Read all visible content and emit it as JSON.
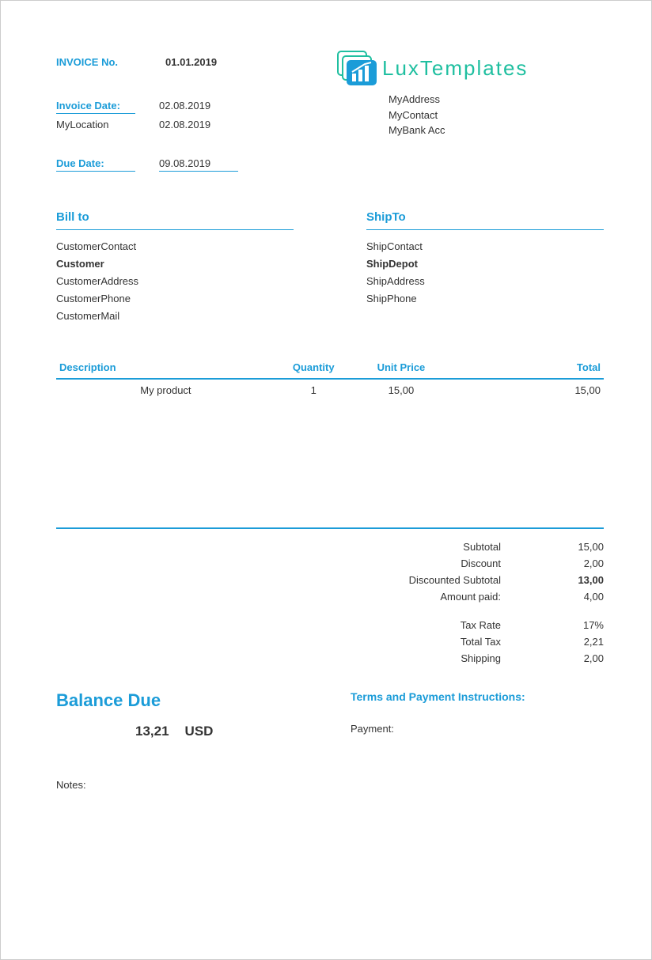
{
  "header": {
    "invoice_no_label": "INVOICE No.",
    "invoice_no_value": "01.01.2019",
    "invoice_date_label": "Invoice Date:",
    "invoice_date_value": "02.08.2019",
    "location_label": "MyLocation",
    "location_value": "02.08.2019",
    "due_date_label": "Due Date:",
    "due_date_value": "09.08.2019"
  },
  "company": {
    "logo_text": "LuxTemplates",
    "address": "MyAddress",
    "contact": "MyContact",
    "bank": "MyBank Acc"
  },
  "billto": {
    "title": "Bill to",
    "contact": "CustomerContact",
    "name": "Customer",
    "address": "CustomerAddress",
    "phone": "CustomerPhone",
    "mail": "CustomerMail"
  },
  "shipto": {
    "title": "ShipTo",
    "contact": "ShipContact",
    "name": "ShipDepot",
    "address": "ShipAddress",
    "phone": "ShipPhone"
  },
  "items": {
    "headers": {
      "description": "Description",
      "quantity": "Quantity",
      "unit_price": "Unit Price",
      "total": "Total"
    },
    "rows": [
      {
        "description": "My product",
        "quantity": "1",
        "unit_price": "15,00",
        "total": "15,00"
      }
    ]
  },
  "totals": {
    "subtotal_label": "Subtotal",
    "subtotal_value": "15,00",
    "discount_label": "Discount",
    "discount_value": "2,00",
    "discounted_label": "Discounted Subtotal",
    "discounted_value": "13,00",
    "amount_paid_label": "Amount paid:",
    "amount_paid_value": "4,00",
    "tax_rate_label": "Tax Rate",
    "tax_rate_value": "17%",
    "total_tax_label": "Total Tax",
    "total_tax_value": "2,21",
    "shipping_label": "Shipping",
    "shipping_value": "2,00"
  },
  "balance": {
    "title": "Balance Due",
    "amount": "13,21",
    "currency": "USD"
  },
  "terms": {
    "title": "Terms and Payment Instructions:",
    "payment_label": "Payment:"
  },
  "notes": {
    "label": "Notes:"
  }
}
